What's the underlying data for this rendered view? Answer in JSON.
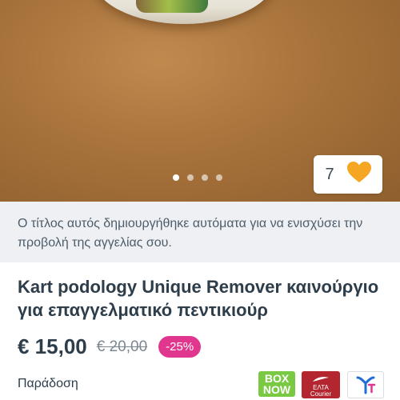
{
  "gallery": {
    "image_count": 4,
    "active_index": 0,
    "favorite_count": "7",
    "heart_color": "#f5a623"
  },
  "notice": {
    "text": "Ο τίτλος αυτός δημιουργήθηκε αυτόματα για να ενισχύσει την προβολή της αγγελίας σου."
  },
  "listing": {
    "title": "Kart podology Unique Remover καινούργιο για επαγγελματικό πεντικιούρ",
    "price": "€ 15,00",
    "old_price": "€ 20,00",
    "discount": "-25%"
  },
  "delivery": {
    "label": "Παράδοση",
    "carriers": [
      {
        "name": "BOX NOW",
        "line1": "BOX",
        "line2": "NOW",
        "color": "#7ac943"
      },
      {
        "name": "ΕΛΤΑ Courier",
        "line1": "ΕΛΤΑ",
        "line2": "Courier",
        "color": "#b3262f"
      },
      {
        "name": "skroutz-point-icon",
        "color": "#ffffff"
      }
    ]
  },
  "colors": {
    "accent_pink": "#e0368e",
    "text_dark": "#2e3d4a",
    "notice_bg": "#eef0f3"
  }
}
